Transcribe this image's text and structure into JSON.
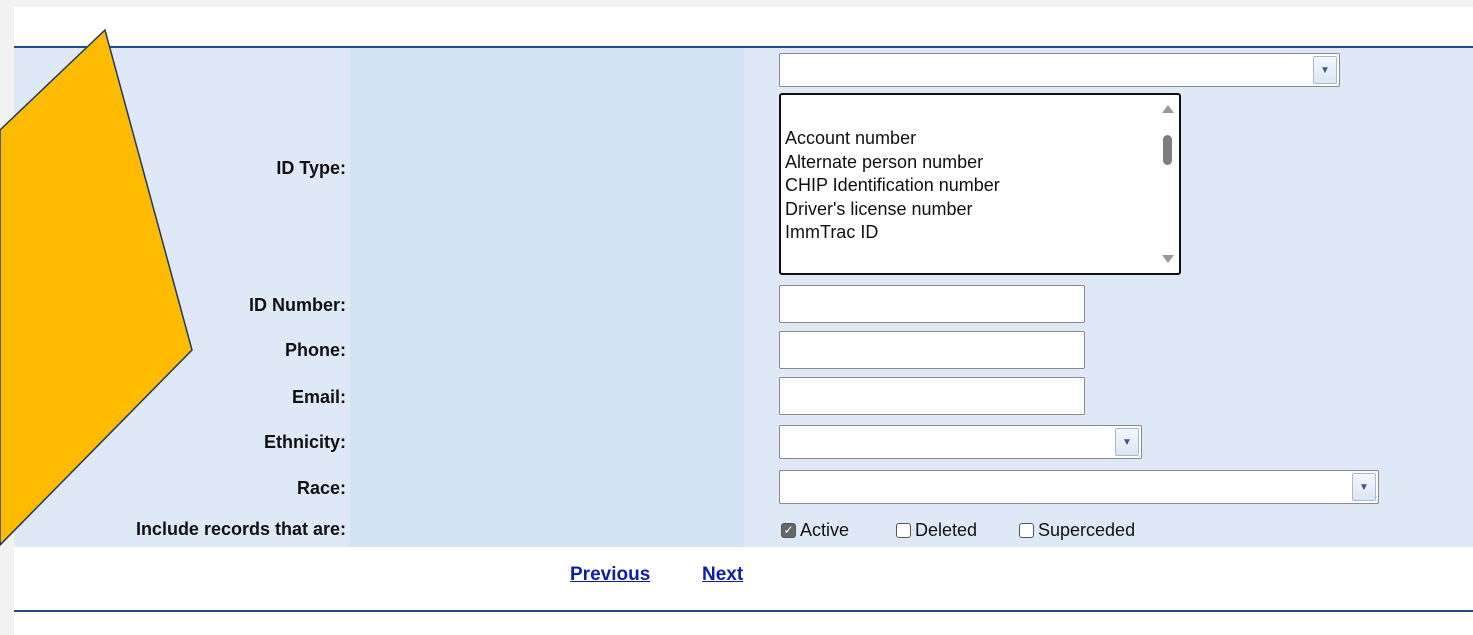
{
  "form": {
    "labels": {
      "id_type": "ID Type:",
      "id_number": "ID Number:",
      "phone": "Phone:",
      "email": "Email:",
      "ethnicity": "Ethnicity:",
      "race": "Race:",
      "include_records": "Include records that are:"
    },
    "id_type_select": {
      "value": ""
    },
    "id_type_options": [
      "Account number",
      "Alternate person number",
      "CHIP Identification number",
      "Driver's license number",
      "ImmTrac ID"
    ],
    "id_number": {
      "value": ""
    },
    "phone": {
      "value": ""
    },
    "email": {
      "value": ""
    },
    "ethnicity": {
      "value": ""
    },
    "race": {
      "value": ""
    },
    "record_filters": [
      {
        "label": "Active",
        "checked": true
      },
      {
        "label": "Deleted",
        "checked": false
      },
      {
        "label": "Superceded",
        "checked": false
      }
    ]
  },
  "nav": {
    "previous": "Previous",
    "next": "Next"
  },
  "colors": {
    "panel_bg": "#dfe8f6",
    "middle_column_bg": "#d2e4f4",
    "rule": "#1f4e8c",
    "link": "#0b1fa8",
    "callout_arrow": "#ffbb00"
  }
}
